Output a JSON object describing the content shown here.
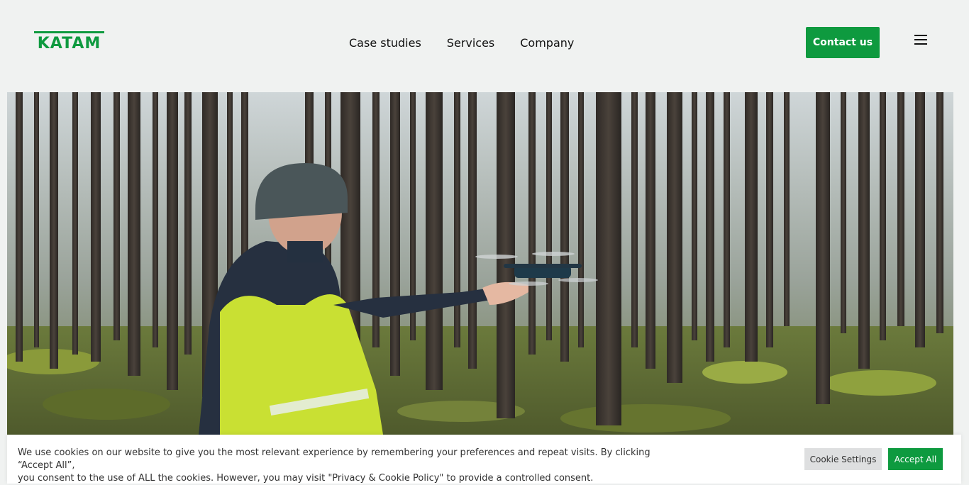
{
  "header": {
    "logo_text": "KATAM",
    "nav": [
      "Case studies",
      "Services",
      "Company"
    ],
    "contact_label": "Contact us",
    "menu_icon": "hamburger-menu-icon"
  },
  "hero": {
    "image": "forest-drone-photo"
  },
  "cookie": {
    "text_line1": "We use cookies on our website to give you the most relevant experience by remembering your preferences and repeat visits. By clicking “Accept All”,",
    "text_line2": "you consent to the use of ALL the cookies. However, you may visit \"Privacy & Cookie Policy\" to provide a controlled consent.",
    "settings_label": "Cookie Settings",
    "accept_label": "Accept All"
  },
  "colors": {
    "brand_green": "#0e9a3f",
    "page_background": "#f0f2f1"
  }
}
